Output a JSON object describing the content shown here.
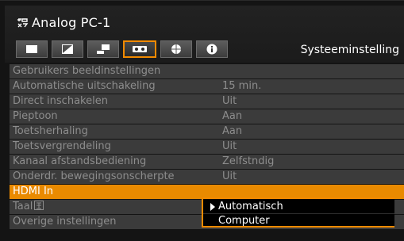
{
  "header": {
    "title": "Analog PC-1",
    "section_title": "Systeeminstelling",
    "tabs": [
      {
        "icon": "image-adjust-icon",
        "active": false
      },
      {
        "icon": "contrast-icon",
        "active": false
      },
      {
        "icon": "installation-icon",
        "active": false
      },
      {
        "icon": "system-settings-icon",
        "active": true
      },
      {
        "icon": "network-icon",
        "active": false
      },
      {
        "icon": "info-icon",
        "active": false
      }
    ]
  },
  "menu": {
    "items": [
      {
        "label": "Gebruikers beeldinstellingen",
        "value": ""
      },
      {
        "label": "Automatische uitschakeling",
        "value": "15 min."
      },
      {
        "label": "Direct inschakelen",
        "value": "Uit"
      },
      {
        "label": "Pieptoon",
        "value": "Aan"
      },
      {
        "label": "Toetsherhaling",
        "value": "Aan"
      },
      {
        "label": "Toetsvergrendeling",
        "value": "Uit"
      },
      {
        "label": "Kanaal afstandsbediening",
        "value": "Zelfstndig"
      },
      {
        "label": "Onderdr. bewegingsonscherpte",
        "value": "Uit"
      },
      {
        "label": "HDMI In",
        "value": ""
      },
      {
        "label": "Taal",
        "value": ""
      },
      {
        "label": "Overige instellingen",
        "value": ""
      }
    ]
  },
  "dropdown": {
    "options": [
      "Automatisch",
      "Computer"
    ],
    "selected_index": 0
  },
  "colors": {
    "accent": "#f28a00",
    "row_bg": "#3b3b3b",
    "row_text": "#8d8d8d"
  }
}
